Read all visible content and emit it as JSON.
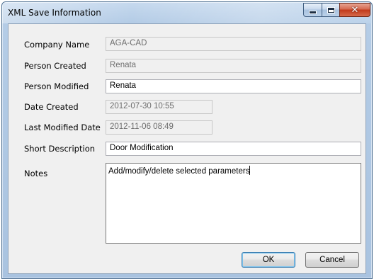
{
  "window": {
    "title": "XML Save Information",
    "controls": {
      "minimize_icon": "minimize-icon",
      "maximize_icon": "maximize-icon",
      "close_icon": "close-icon",
      "close_glyph": "✕"
    }
  },
  "form": {
    "company_name": {
      "label": "Company Name",
      "value": "AGA-CAD",
      "readonly": true
    },
    "person_created": {
      "label": "Person Created",
      "value": "Renata",
      "readonly": true
    },
    "person_modified": {
      "label": "Person Modified",
      "value": "Renata",
      "readonly": false
    },
    "date_created": {
      "label": "Date Created",
      "value": "2012-07-30 10:55",
      "readonly": true
    },
    "last_modified_date": {
      "label": "Last Modified Date",
      "value": "2012-11-06 08:49",
      "readonly": true
    },
    "short_description": {
      "label": "Short Description",
      "value": "Door Modification",
      "readonly": false
    },
    "notes": {
      "label": "Notes",
      "value": "Add/modify/delete selected parameters",
      "readonly": false
    }
  },
  "buttons": {
    "ok": "OK",
    "cancel": "Cancel"
  },
  "colors": {
    "title_bar": "#b4cce6",
    "client_background": "#f0f0f0",
    "close_button": "#c2391a",
    "readonly_text": "#6d6d6d"
  }
}
